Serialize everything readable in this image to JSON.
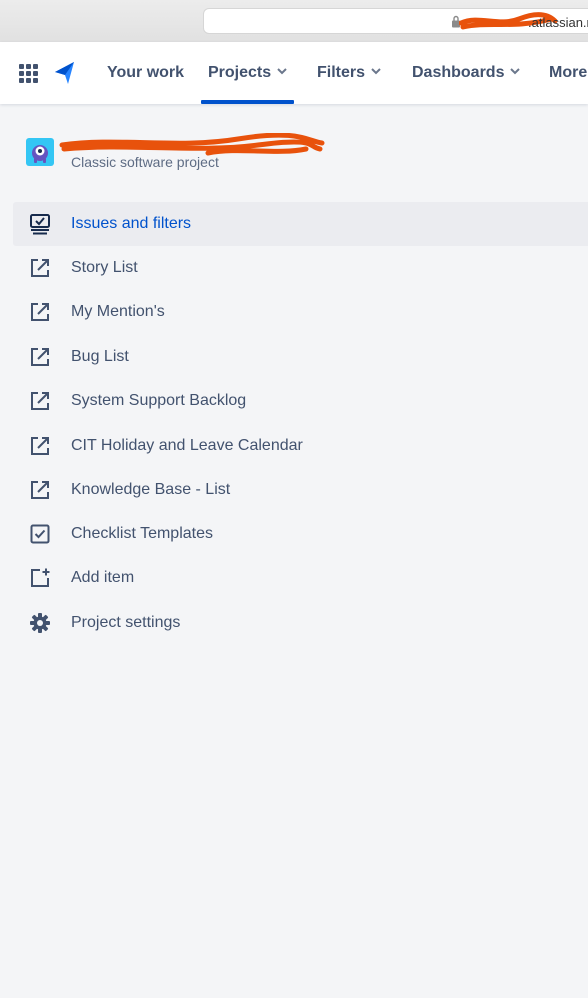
{
  "browser": {
    "url_suffix": ".atlassian.n"
  },
  "nav": {
    "items": [
      {
        "label": "Your work",
        "has_chevron": false
      },
      {
        "label": "Projects",
        "has_chevron": true,
        "active": true
      },
      {
        "label": "Filters",
        "has_chevron": true
      },
      {
        "label": "Dashboards",
        "has_chevron": true
      },
      {
        "label": "More",
        "has_chevron": false
      }
    ]
  },
  "project": {
    "name": "",
    "type": "Classic software project",
    "avatar_color": "#34c6f4"
  },
  "sidebar": {
    "items": [
      {
        "label": "Issues and filters",
        "icon": "issues-icon",
        "selected": true
      },
      {
        "label": "Story List",
        "icon": "external-link-icon"
      },
      {
        "label": "My Mention's",
        "icon": "external-link-icon"
      },
      {
        "label": "Bug List",
        "icon": "external-link-icon"
      },
      {
        "label": "System Support Backlog",
        "icon": "external-link-icon"
      },
      {
        "label": "CIT Holiday and Leave Calendar",
        "icon": "external-link-icon"
      },
      {
        "label": "Knowledge Base - List",
        "icon": "external-link-icon"
      },
      {
        "label": "Checklist Templates",
        "icon": "checkbox-icon"
      },
      {
        "label": "Add item",
        "icon": "add-item-icon"
      },
      {
        "label": "Project settings",
        "icon": "gear-icon"
      }
    ]
  },
  "colors": {
    "accent": "#0052cc",
    "text": "#42526e",
    "selected_bg": "#ebecf0",
    "page_bg": "#f4f5f7",
    "redaction": "#e8520c"
  }
}
